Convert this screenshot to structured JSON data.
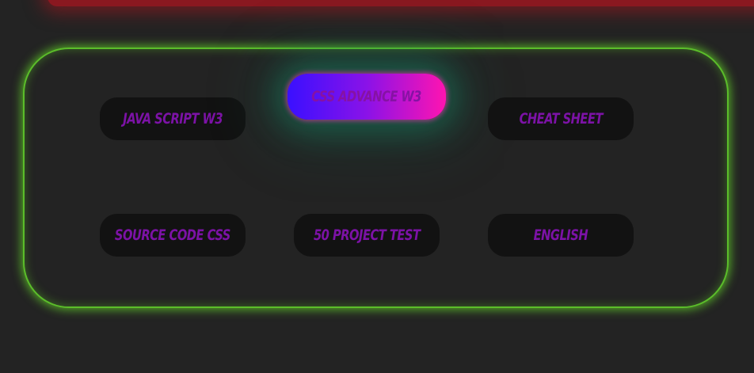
{
  "links": [
    {
      "label": "JAVA SCRIPT W3",
      "active": false
    },
    {
      "label": "CSS ADVANCE W3",
      "active": true
    },
    {
      "label": "CHEAT SHEET",
      "active": false
    },
    {
      "label": "SOURCE CODE CSS",
      "active": false
    },
    {
      "label": "50 PROJECT TEST",
      "active": false
    },
    {
      "label": "ENGLISH",
      "active": false
    }
  ],
  "colors": {
    "background": "#232323",
    "panel_border": "#5bbd2a",
    "button_bg": "#121212",
    "label_text": "#7c12a6",
    "active_gradient_start": "#3a10ff",
    "active_gradient_end": "#ff14b0",
    "active_glow": "#14966e",
    "top_bar": "#8a1820"
  }
}
